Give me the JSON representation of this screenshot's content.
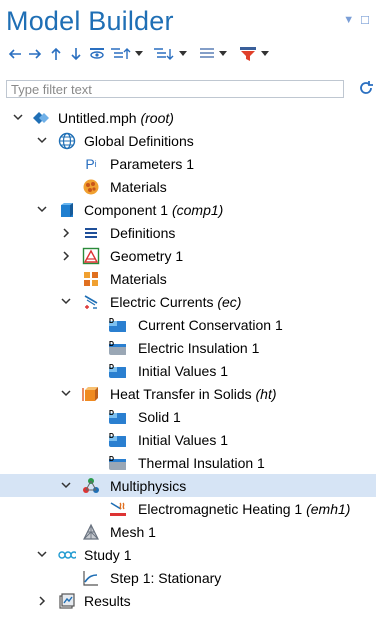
{
  "panel": {
    "title": "Model Builder",
    "filter_placeholder": "Type filter text"
  },
  "tree": {
    "root": {
      "label": "Untitled.mph",
      "tag": "(root)"
    },
    "global_definitions": {
      "label": "Global Definitions"
    },
    "parameters": {
      "label": "Parameters 1"
    },
    "global_materials": {
      "label": "Materials"
    },
    "component": {
      "label": "Component 1",
      "tag": "(comp1)"
    },
    "definitions": {
      "label": "Definitions"
    },
    "geometry": {
      "label": "Geometry 1"
    },
    "materials": {
      "label": "Materials"
    },
    "electric_currents": {
      "label": "Electric Currents",
      "tag": "(ec)"
    },
    "current_conservation": {
      "label": "Current Conservation 1"
    },
    "electric_insulation": {
      "label": "Electric Insulation 1"
    },
    "ec_initial_values": {
      "label": "Initial Values 1"
    },
    "heat_transfer": {
      "label": "Heat Transfer in Solids",
      "tag": "(ht)"
    },
    "solid": {
      "label": "Solid 1"
    },
    "ht_initial_values": {
      "label": "Initial Values 1"
    },
    "thermal_insulation": {
      "label": "Thermal Insulation 1"
    },
    "multiphysics": {
      "label": "Multiphysics"
    },
    "em_heating": {
      "label": "Electromagnetic Heating 1",
      "tag": "(emh1)"
    },
    "mesh": {
      "label": "Mesh 1"
    },
    "study": {
      "label": "Study 1"
    },
    "step": {
      "label": "Step 1: Stationary"
    },
    "results": {
      "label": "Results"
    }
  },
  "colors": {
    "title": "#1f6fb5",
    "selection": "#d6e4f5",
    "accent": "#2a6fc0"
  }
}
